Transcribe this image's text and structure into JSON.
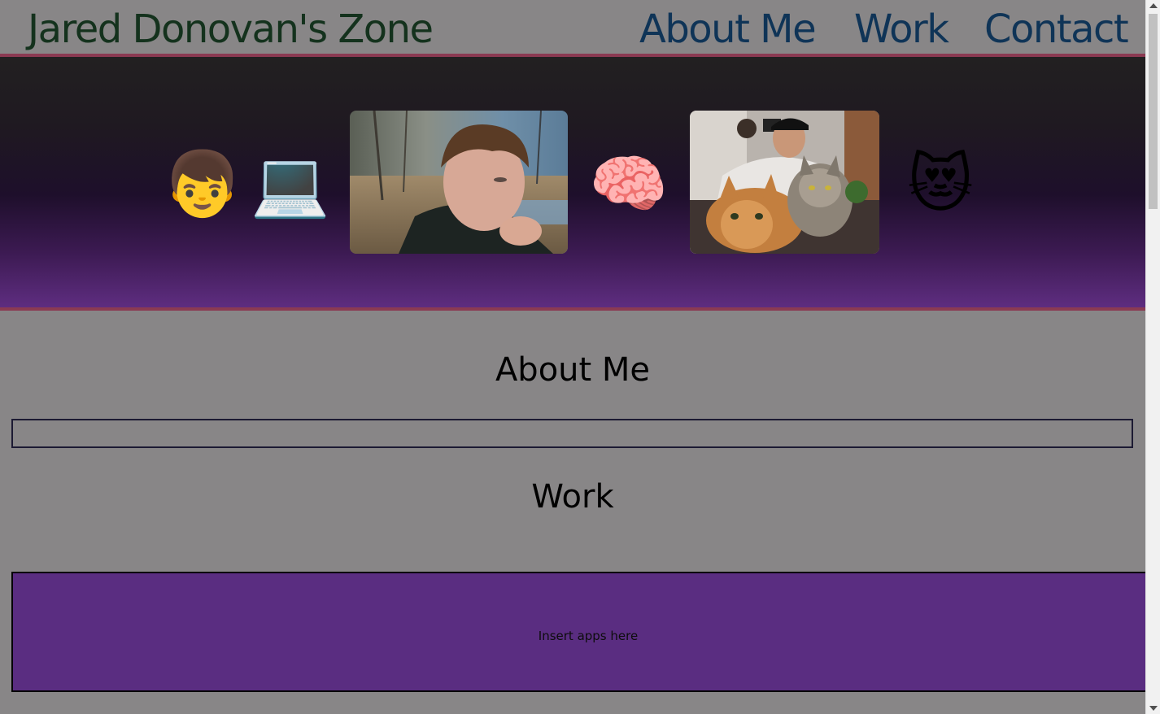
{
  "header": {
    "site_title": "Jared Donovan's Zone",
    "nav": [
      {
        "label": "About Me"
      },
      {
        "label": "Work"
      },
      {
        "label": "Contact"
      }
    ]
  },
  "hero": {
    "emojis": {
      "boy": "👦",
      "laptop": "💻",
      "brain": "🧠",
      "cat": "😻"
    },
    "photos": [
      "portrait-photo",
      "cats-photo"
    ]
  },
  "about": {
    "title": "About Me"
  },
  "work": {
    "title": "Work",
    "placeholder_text": "Insert apps here"
  },
  "colors": {
    "page_bg": "#888687",
    "accent_border": "#8b3a52",
    "title_color": "#14321d",
    "nav_color": "#0f3457",
    "work_box_bg": "#5a2d81"
  }
}
